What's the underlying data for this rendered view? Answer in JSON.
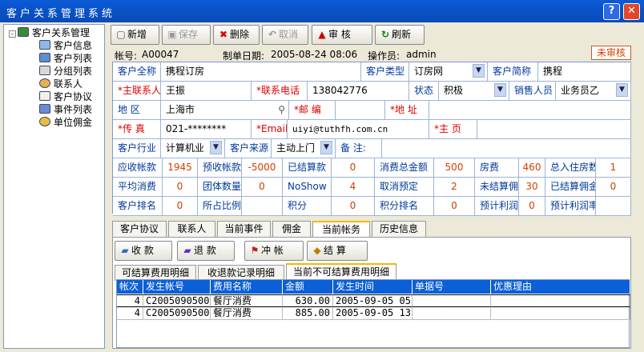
{
  "window": {
    "title": "客户关系管理系统",
    "help_glyph": "?",
    "close_glyph": "✕"
  },
  "tree": {
    "root": "客户关系管理",
    "items": [
      "客户信息",
      "客户列表",
      "分组列表",
      "联系人",
      "客户协议",
      "事件列表",
      "单位佣金"
    ]
  },
  "toolbar": {
    "add": "新增",
    "save": "保存",
    "delete": "删除",
    "cancel": "取消",
    "audit": "审 核",
    "refresh": "刷新"
  },
  "header": {
    "account_label": "帐号:",
    "account": "A00047",
    "date_label": "制单日期:",
    "date": "2005-08-24 08:06",
    "operator_label": "操作员:",
    "operator": "admin",
    "status": "未审核"
  },
  "form": {
    "full_name_label": "客户全称",
    "full_name": "携程订房",
    "type_label": "客户类型",
    "type": "订房网",
    "short_label": "客户简称",
    "short": "携程",
    "contact_label": "*主联系人",
    "contact": "王振",
    "phone_label": "*联系电话",
    "phone": "138042776",
    "state_label": "状态",
    "state": "积极",
    "sales_label": "销售人员",
    "sales": "业务员乙",
    "region_label": "地  区",
    "region": "上海市",
    "zip_label": "*邮  编",
    "zip": "",
    "addr_label": "*地  址",
    "addr": "",
    "fax_label": "*传  真",
    "fax": "021-********",
    "email_label": "*Email",
    "email": "uiyi@tuthfh.com.cn",
    "home_label": "*主  页",
    "home": "",
    "industry_label": "客户行业",
    "industry": "计算机业",
    "source_label": "客户来源",
    "source": "主动上门",
    "remark_label": "备  注:",
    "remark": ""
  },
  "stats": {
    "r1": [
      [
        "应收帐款",
        "1945"
      ],
      [
        "预收帐款",
        "-5000"
      ],
      [
        "已结算款",
        "0"
      ],
      [
        "消费总金额",
        "500"
      ],
      [
        "房费",
        "460"
      ],
      [
        "总入住房数",
        "1"
      ]
    ],
    "r2": [
      [
        "平均消费",
        "0"
      ],
      [
        "团体数量",
        "0"
      ],
      [
        "NoShow",
        "4"
      ],
      [
        "取消预定",
        "2"
      ],
      [
        "未结算佣金",
        "30"
      ],
      [
        "已结算佣金",
        "0"
      ]
    ],
    "r3": [
      [
        "客户排名",
        "0"
      ],
      [
        "所占比例",
        ""
      ],
      [
        "积分",
        "0"
      ],
      [
        "积分排名",
        "0"
      ],
      [
        "预计利润额",
        "0"
      ],
      [
        "预计利润率",
        ""
      ]
    ]
  },
  "tabs": [
    "客户协议",
    "联系人",
    "当前事件",
    "佣金",
    "当前帐务",
    "历史信息"
  ],
  "actions": {
    "receive": "收 款",
    "refund": "退 款",
    "offset": "冲 帐",
    "settle": "结 算"
  },
  "subtabs": [
    "可结算费用明细",
    "收退款记录明细",
    "当前不可结算费用明细"
  ],
  "table": {
    "headers": [
      "帐次",
      "发生帐号",
      "费用名称",
      "金额",
      "发生时间",
      "单据号",
      "优惠理由"
    ],
    "rows": [
      [
        "4",
        "C20050905001",
        "餐厅消费",
        "630.00",
        "2005-09-05 05:04",
        "",
        ""
      ],
      [
        "4",
        "C20050905002",
        "餐厅消费",
        "885.00",
        "2005-09-05 13:24",
        "",
        ""
      ]
    ]
  },
  "colors": {
    "title_bar": "#0a5bd9",
    "label_text": "#003a9c",
    "value_accent": "#d24000",
    "table_header": "#0b5fd8"
  }
}
